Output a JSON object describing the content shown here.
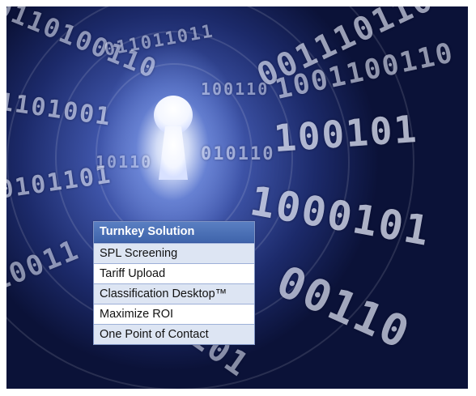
{
  "menu": {
    "header": "Turnkey Solution",
    "items": [
      {
        "label": "SPL Screening"
      },
      {
        "label": "Tariff Upload"
      },
      {
        "label": "Classification Desktop™"
      },
      {
        "label": "Maximize ROI"
      },
      {
        "label": "One Point of Contact"
      }
    ]
  },
  "colors": {
    "header_bg": "#4a6fb7",
    "row_alt_bg": "#dde5f3",
    "background_dark": "#0b1238",
    "background_glow": "#6a7fd1"
  },
  "icons": [
    "keyhole-icon"
  ]
}
